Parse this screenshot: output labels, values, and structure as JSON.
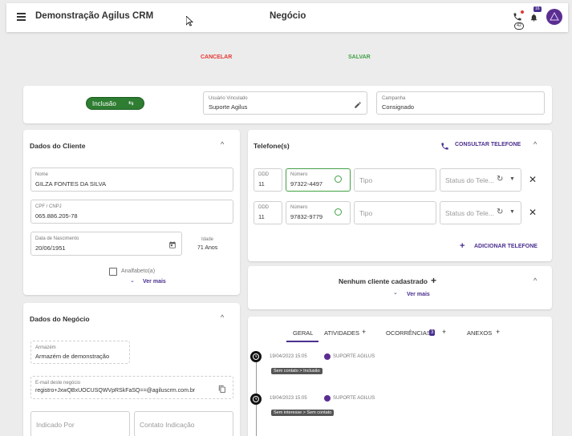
{
  "header": {
    "app_title": "Demonstração Agilus CRM",
    "page_title": "Negócio",
    "phone_badge": "42",
    "notif_badge": "16"
  },
  "actions": {
    "cancel": "CANCELAR",
    "save": "SALVAR"
  },
  "top_panel": {
    "toggle_label": "Inclusão",
    "usuario_label": "Usuário Vinculado",
    "usuario_value": "Suporte Agilus",
    "campanha_label": "Campanha",
    "campanha_value": "Consignado"
  },
  "cliente": {
    "title": "Dados do Cliente",
    "nome_label": "Nome",
    "nome_value": "GILZA FONTES DA SILVA",
    "cpf_label": "CPF / CNPJ",
    "cpf_value": "065.886.205-78",
    "nasc_label": "Data de Nascimento",
    "nasc_value": "20/06/1951",
    "idade_label": "Idade",
    "idade_value": "71 Anos",
    "analfabeto_label": "Analfabeto(a)",
    "ver_mais": "Ver mais"
  },
  "telefones": {
    "title": "Telefone(s)",
    "consultar": "CONSULTAR TELEFONE",
    "rows": [
      {
        "ddd_label": "DDD",
        "ddd": "11",
        "num_label": "Número",
        "num": "97322-4497",
        "tipo_ph": "Tipo",
        "status_ph": "Status do Tele..."
      },
      {
        "ddd_label": "DDD",
        "ddd": "11",
        "num_label": "Número",
        "num": "97832-9779",
        "tipo_ph": "Tipo",
        "status_ph": "Status do Tele..."
      }
    ],
    "adicionar": "ADICIONAR TELEFONE"
  },
  "cliente_cadastrado": {
    "title": "Nenhum cliente cadastrado",
    "ver_mais": "Ver mais"
  },
  "negocio": {
    "title": "Dados do Negócio",
    "armazem_label": "Armazém",
    "armazem_value": "Armazém de demonstração",
    "email_label": "E-mail deste negócio",
    "email_value": "registro+JxwQBxUOCUSQWVpRSkFaSQ==@agiluscrm.com.br",
    "indicado_ph": "Indicado Por",
    "contato_ph": "Contato Indicação"
  },
  "timeline": {
    "tabs": {
      "geral": "GERAL",
      "atividades": "ATIVIDADES",
      "ocorrencias": "OCORRÊNCIAS",
      "ocorrencias_count": "3",
      "anexos": "ANEXOS"
    },
    "entries": [
      {
        "date": "19/04/2023 15:05",
        "user": "SUPORTE AGILUS",
        "tag": "Sem contato > Inclusão"
      },
      {
        "date": "19/04/2023 15:05",
        "user": "SUPORTE AGILUS",
        "tag": "Sem interesse > Sem contato"
      }
    ]
  },
  "colors": {
    "purple": "#4a2f8f",
    "green": "#2e7d32",
    "cancel_red": "#e53935",
    "save_green": "#43a047"
  }
}
